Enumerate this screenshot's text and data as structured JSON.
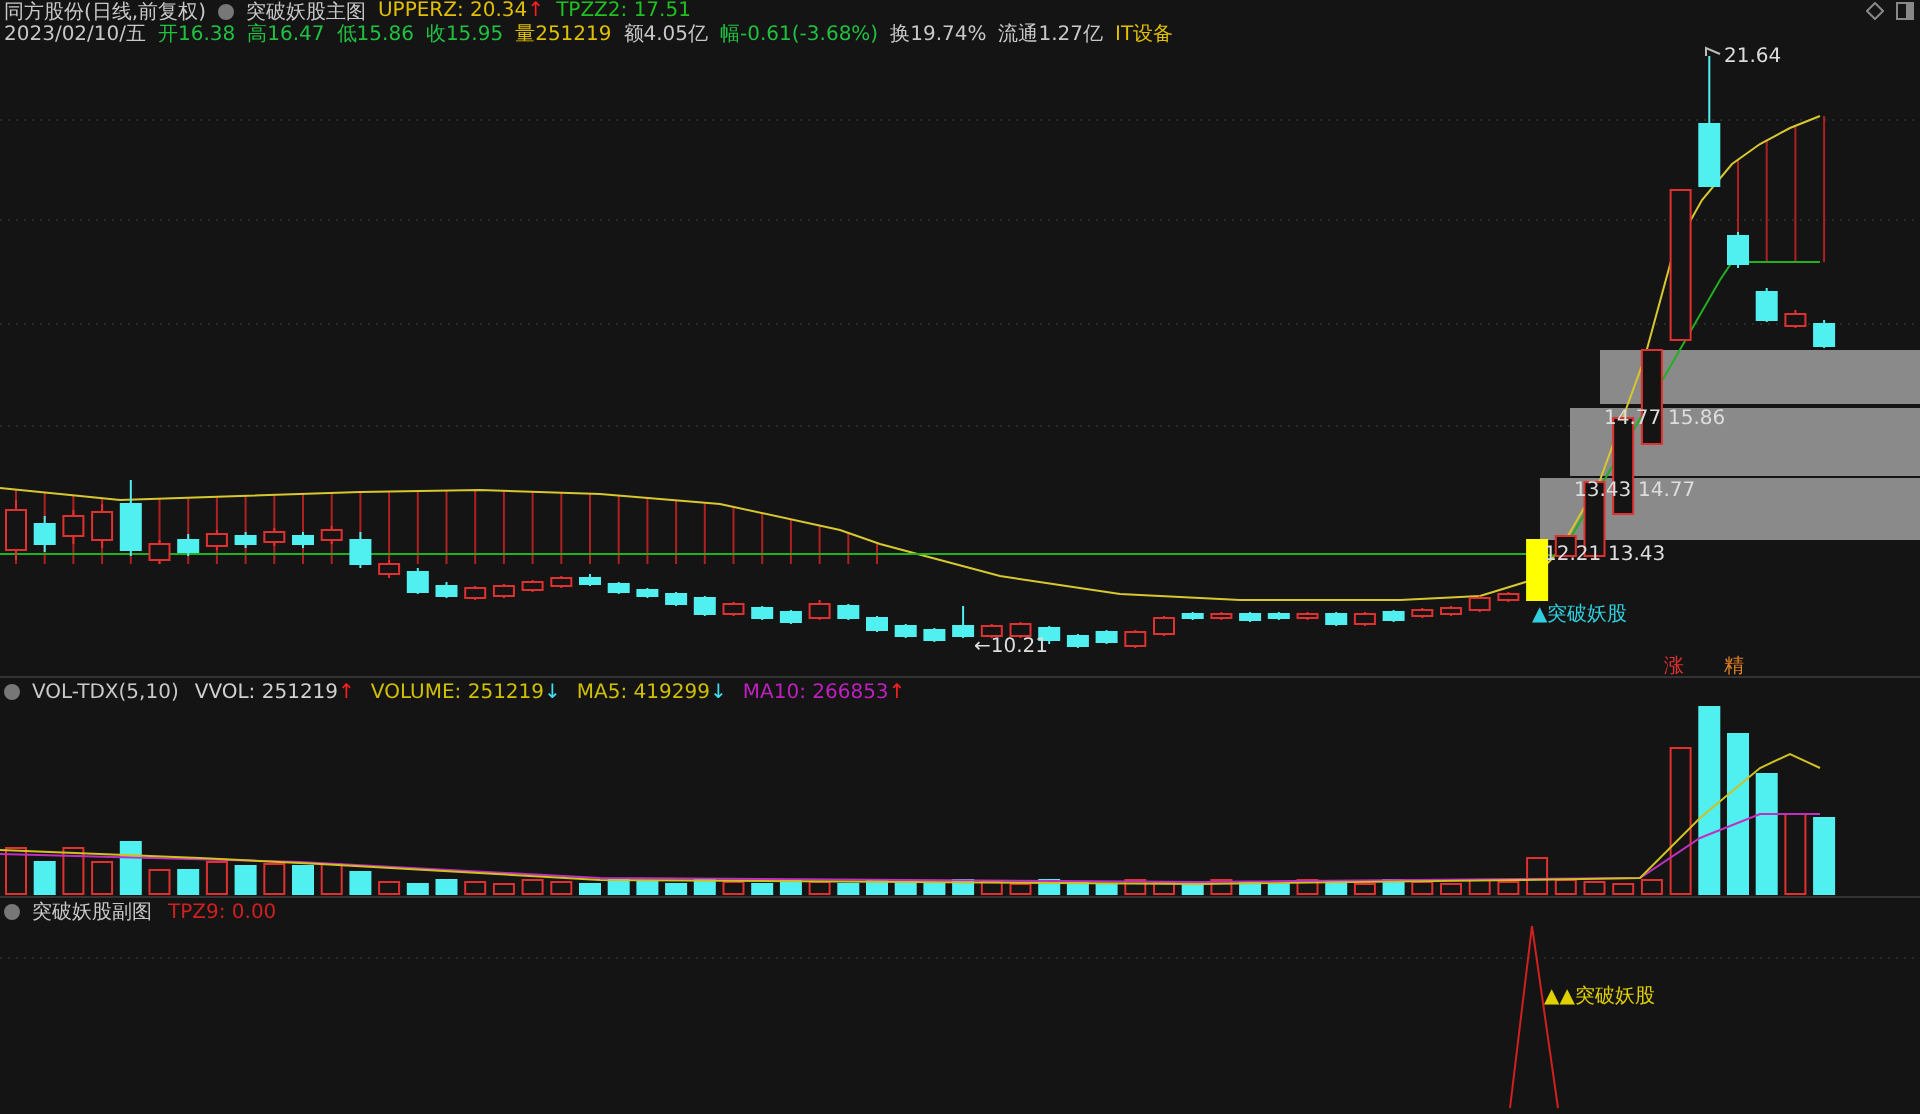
{
  "header": {
    "title": "同方股份(日线,前复权)",
    "indicator": "突破妖股主图",
    "values": [
      {
        "text": "UPPERZ: 20.34",
        "color": "#e0c000",
        "arrow": {
          "text": "↑",
          "color": "#ff2020"
        }
      },
      {
        "text": "TPZZ2: 17.51",
        "color": "#20c020"
      }
    ],
    "quote": [
      {
        "text": "2023/02/10/五",
        "color": "#c8c8c8"
      },
      {
        "text": "开16.38",
        "color": "#20c040"
      },
      {
        "text": "高16.47",
        "color": "#20c040"
      },
      {
        "text": "低15.86",
        "color": "#20c040"
      },
      {
        "text": "收15.95",
        "color": "#20c040"
      },
      {
        "text": "量251219",
        "color": "#e0c000"
      },
      {
        "text": "额4.05亿",
        "color": "#c8c8c8"
      },
      {
        "text": "幅-0.61(-3.68%)",
        "color": "#20c040"
      },
      {
        "text": "换19.74%",
        "color": "#c8c8c8"
      },
      {
        "text": "流通1.27亿",
        "color": "#c8c8c8"
      },
      {
        "text": "IT设备",
        "color": "#e0c000"
      }
    ]
  },
  "main_chart": {
    "high_label": "21.64",
    "low_label": "←10.21",
    "zones": [
      {
        "labels": [
          "14.77",
          "15.86"
        ]
      },
      {
        "labels": [
          "13.43",
          "14.77"
        ]
      },
      {
        "labels": [
          "12.21",
          "13.43"
        ]
      }
    ],
    "signal": "▲突破妖股",
    "markers": [
      {
        "text": "涨",
        "color": "#e03030"
      },
      {
        "text": "精",
        "color": "#e08020"
      }
    ]
  },
  "volume_panel": {
    "name": "VOL-TDX(5,10)",
    "values": [
      {
        "text": "VVOL: 251219",
        "color": "#d0d0d0",
        "arrow": {
          "text": "↑",
          "color": "#ff2020"
        }
      },
      {
        "text": "VOLUME: 251219",
        "color": "#d0c000",
        "arrow": {
          "text": "↓",
          "color": "#40e0f0"
        }
      },
      {
        "text": "MA5: 419299",
        "color": "#d0c000",
        "arrow": {
          "text": "↓",
          "color": "#40e0f0"
        }
      },
      {
        "text": "MA10: 266853",
        "color": "#c020c0",
        "arrow": {
          "text": "↑",
          "color": "#ff2020"
        }
      }
    ]
  },
  "sub_panel": {
    "name": "突破妖股副图",
    "values": [
      {
        "text": "TPZ9: 0.00",
        "color": "#d02020"
      }
    ],
    "signal": "▲▲突破妖股"
  }
}
